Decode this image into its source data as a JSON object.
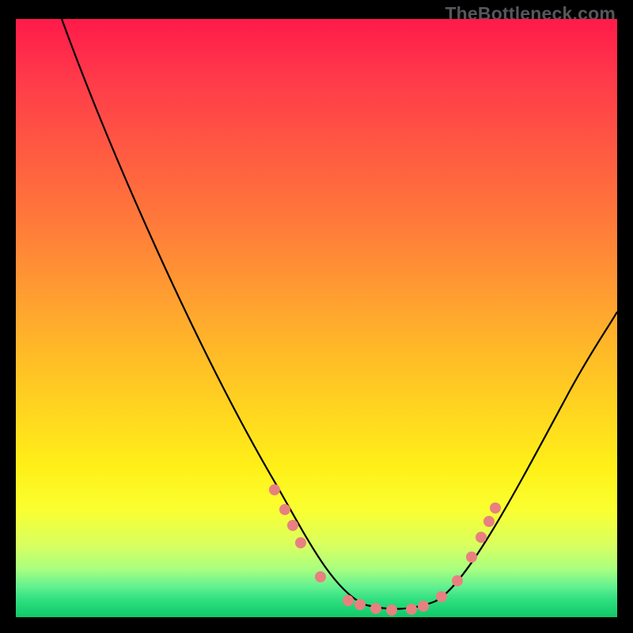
{
  "watermark": "TheBottleneck.com",
  "chart_data": {
    "type": "line",
    "title": "",
    "xlabel": "",
    "ylabel": "",
    "categories": [],
    "x": [
      0.0,
      0.04,
      0.08,
      0.12,
      0.16,
      0.2,
      0.24,
      0.28,
      0.32,
      0.36,
      0.4,
      0.44,
      0.48,
      0.52,
      0.56,
      0.6,
      0.64,
      0.68,
      0.72,
      0.76,
      0.8,
      0.84,
      0.88,
      0.92,
      0.96,
      1.0
    ],
    "values": [
      1.0,
      0.93,
      0.86,
      0.79,
      0.72,
      0.65,
      0.58,
      0.51,
      0.44,
      0.37,
      0.3,
      0.23,
      0.16,
      0.09,
      0.04,
      0.01,
      0.0,
      0.0,
      0.01,
      0.05,
      0.11,
      0.19,
      0.27,
      0.35,
      0.42,
      0.48
    ],
    "ylim": [
      0,
      1
    ],
    "marker_points_x": [
      0.43,
      0.45,
      0.46,
      0.475,
      0.51,
      0.555,
      0.6,
      0.65,
      0.67,
      0.7,
      0.72,
      0.745,
      0.76,
      0.77,
      0.78
    ],
    "marker_points_y": [
      0.21,
      0.175,
      0.15,
      0.12,
      0.06,
      0.02,
      0.005,
      0.005,
      0.01,
      0.03,
      0.06,
      0.1,
      0.135,
      0.155,
      0.175
    ],
    "marker_color": "#e98080",
    "curve_color": "#000000",
    "background": "gradient-heatmap"
  }
}
